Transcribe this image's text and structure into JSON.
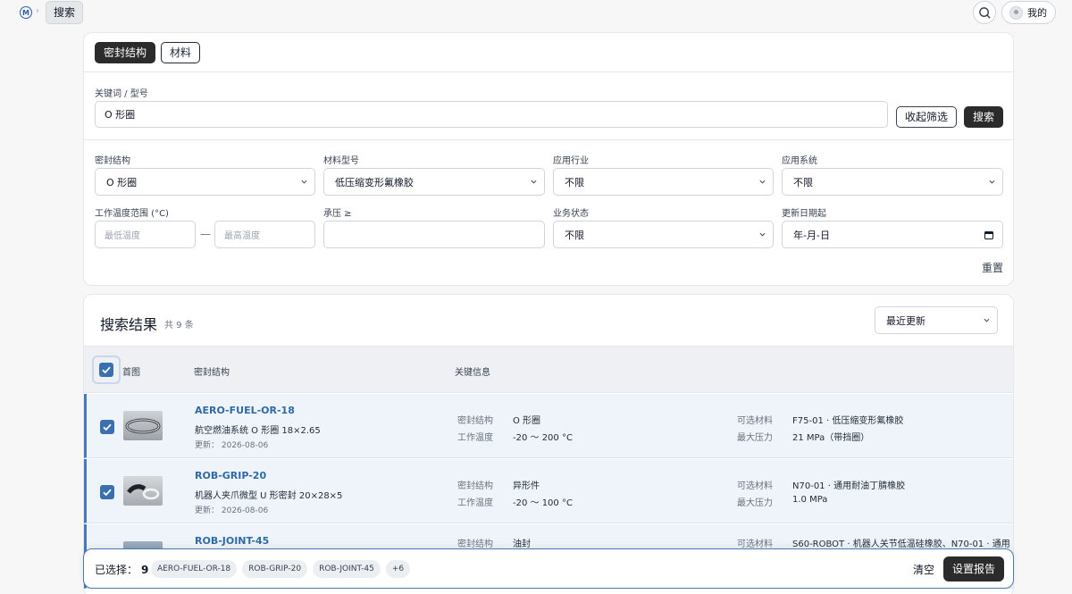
{
  "breadcrumb": {
    "logo": "M",
    "separator": "›",
    "current": "搜索"
  },
  "topbar": {
    "user_label": "我的"
  },
  "tabs": [
    {
      "label": "密封结构",
      "active": true
    },
    {
      "label": "材料",
      "active": false
    }
  ],
  "keyword": {
    "label": "关键词 / 型号",
    "value": "O 形圈",
    "collapse_button": "收起筛选",
    "search_button": "搜索"
  },
  "filters": {
    "seal_structure": {
      "label": "密封结构",
      "value": "O 形圈"
    },
    "material_model": {
      "label": "材料型号",
      "value": "低压缩变形氟橡胶"
    },
    "industry": {
      "label": "应用行业",
      "value": "不限"
    },
    "system": {
      "label": "应用系统",
      "value": "不限"
    },
    "temp_range": {
      "label": "工作温度范围 (°C)",
      "min_placeholder": "最低温度",
      "max_placeholder": "最高温度",
      "dash": "—"
    },
    "pressure": {
      "label": "承压 ≥",
      "value": ""
    },
    "business_status": {
      "label": "业务状态",
      "value": "不限"
    },
    "updated_from": {
      "label": "更新日期起",
      "value": "年-月-日"
    },
    "reset": "重置"
  },
  "results": {
    "title": "搜索结果",
    "count": "共 9 条",
    "sort": "最近更新",
    "columns": {
      "image": "首图",
      "structure": "密封结构",
      "key_info": "关键信息"
    },
    "rows": [
      {
        "sku": "AERO-FUEL-OR-18",
        "desc": "航空燃油系统 O 形圈 18×2.65",
        "updated": "更新：  2026-08-06",
        "k1": "密封结构",
        "v1": "O 形圈",
        "k2": "工作温度",
        "v2": "-20 ～ 200 °C",
        "k3": "可选材料",
        "v3": "F75-01 · 低压缩变形氟橡胶",
        "k4": "最大压力",
        "v4": "21 MPa（带挡圈）",
        "checked": true
      },
      {
        "sku": "ROB-GRIP-20",
        "desc": "机器人夹爪微型 U 形密封 20×28×5",
        "updated": "更新：  2026-08-06",
        "k1": "密封结构",
        "v1": "异形件",
        "k2": "工作温度",
        "v2": "-20 ～ 100 °C",
        "k3": "可选材料",
        "v3": "N70-01 · 通用耐油丁腈橡胶",
        "k4": "最大压力",
        "v4": "1.0 MPa",
        "checked": true
      },
      {
        "sku": "ROB-JOINT-45",
        "desc": "",
        "updated": "",
        "k1": "密封结构",
        "v1": "油封",
        "k2": "",
        "v2": "",
        "k3": "可选材料",
        "v3": "S60-ROBOT · 机器人关节低温硅橡胶、N70-01 · 通用",
        "k4": "",
        "v4": "",
        "checked": true
      }
    ]
  },
  "selection": {
    "label": "已选择：",
    "count": "9",
    "chips": [
      "AERO-FUEL-OR-18",
      "ROB-GRIP-20",
      "ROB-JOINT-45",
      "+6"
    ],
    "clear": "清空",
    "report_button": "设置报告"
  },
  "colors": {
    "accent": "#2f6aa8",
    "dark_button": "#2b2b2b",
    "row_selected": "#eef4fa"
  }
}
